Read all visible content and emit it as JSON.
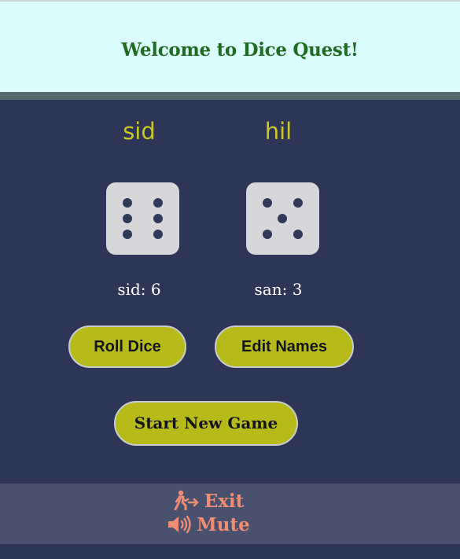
{
  "header": {
    "title": "Welcome to Dice Quest!"
  },
  "players": [
    {
      "name": "sid",
      "die_value": 6,
      "score_label": "sid: 6"
    },
    {
      "name": "hil",
      "die_value": 5,
      "score_label": "san: 3"
    }
  ],
  "buttons": {
    "roll": "Roll Dice",
    "edit": "Edit Names",
    "new_game": "Start New Game"
  },
  "footer": {
    "exit_label": "Exit",
    "exit_icon": "person-exit-icon",
    "mute_label": "Mute",
    "mute_icon": "speaker-icon"
  },
  "colors": {
    "header_bg": "#dcfdfd",
    "title": "#1f6b1f",
    "background": "#2e3657",
    "player_name": "#c9c824",
    "button": "#b6bb19",
    "footer_bg": "#4a516e",
    "footer_text": "#ef8c74"
  }
}
